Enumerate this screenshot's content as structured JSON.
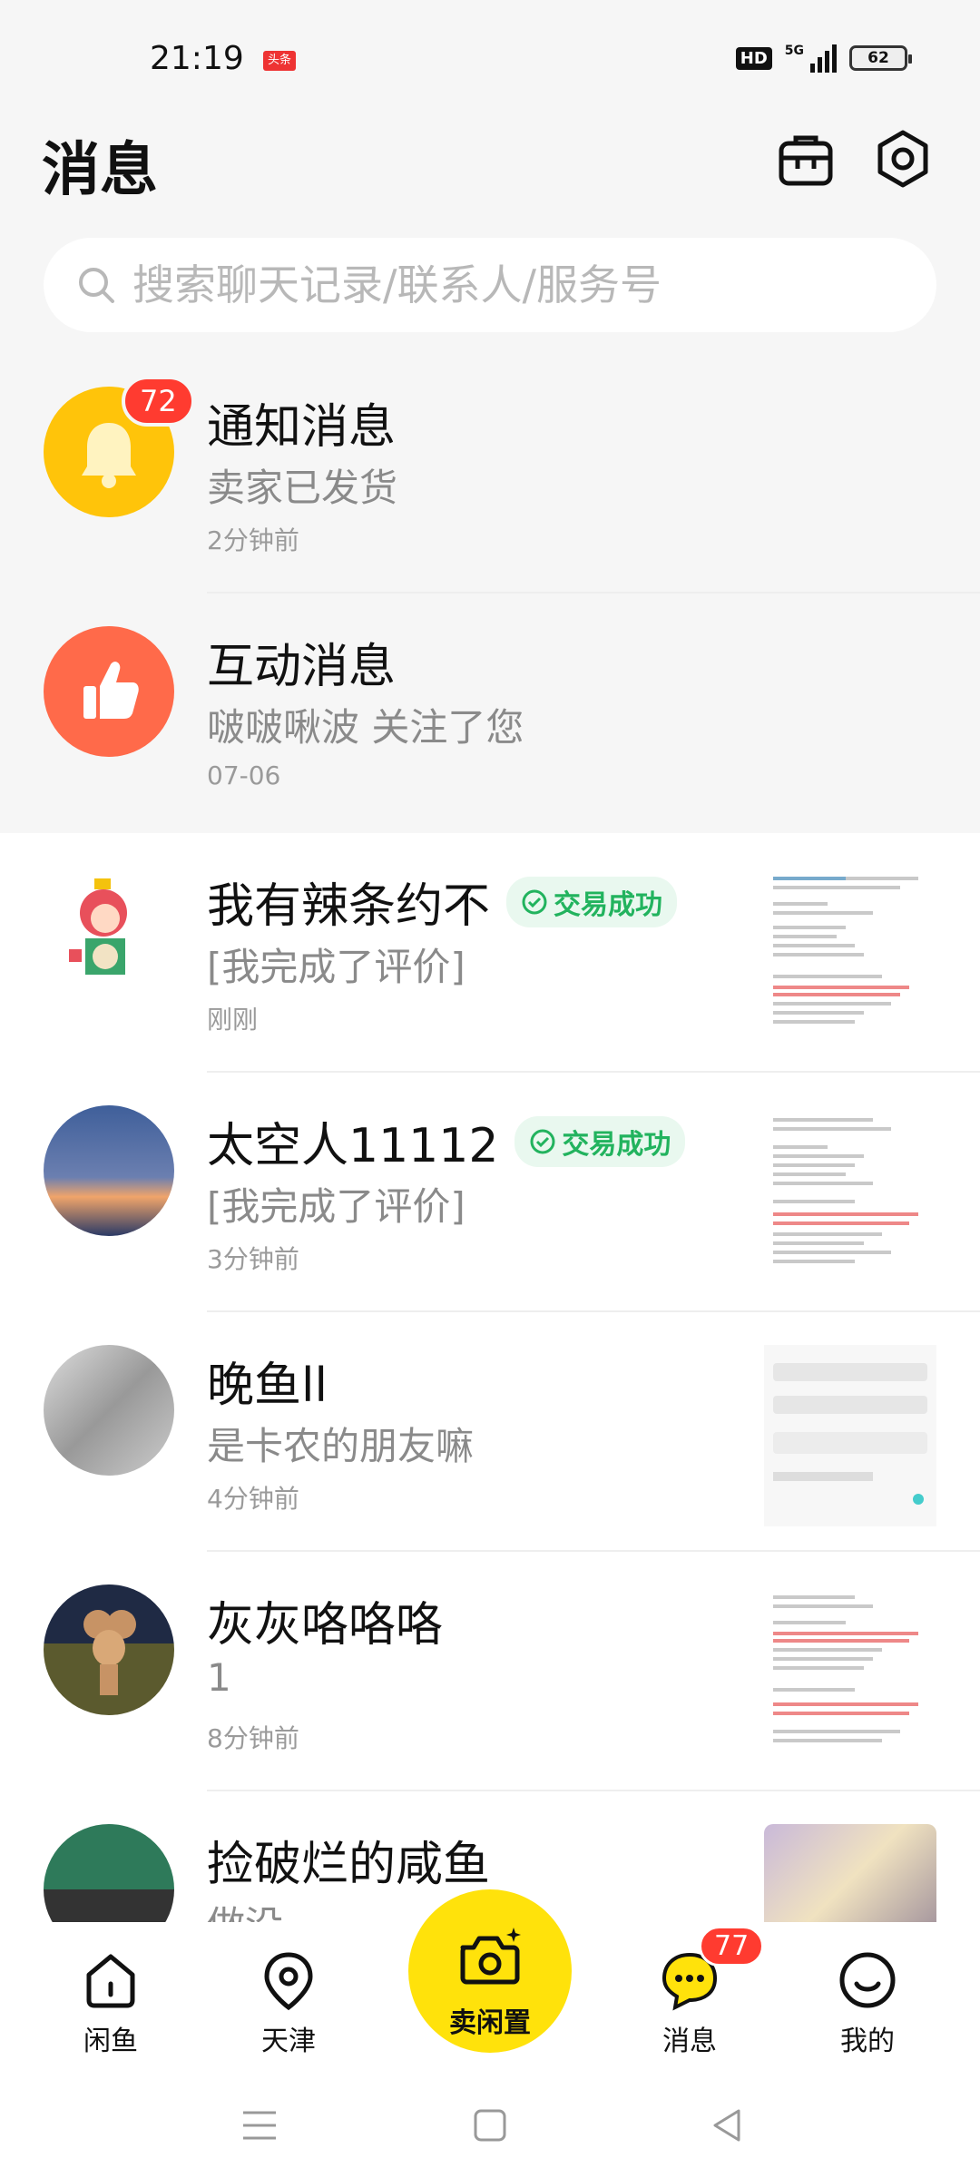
{
  "status_bar": {
    "time": "21:19",
    "news_tag": "头条",
    "hd": "HD",
    "network": "5G",
    "battery": "62"
  },
  "header": {
    "title": "消息",
    "icons": [
      "shopping-bag-icon",
      "settings-icon"
    ]
  },
  "search": {
    "placeholder": "搜索聊天记录/联系人/服务号",
    "icon": "search-icon"
  },
  "messages": [
    {
      "name": "通知消息",
      "preview": "卖家已发货",
      "time": "2分钟前",
      "badge": "72",
      "avatar": "bell-icon",
      "avatar_color": "#ffc40a"
    },
    {
      "name": "互动消息",
      "preview": "啵啵啾波 关注了您",
      "time": "07-06",
      "avatar": "thumbs-up-icon",
      "avatar_color": "#ff6a4a"
    },
    {
      "name": "我有辣条约不",
      "preview": "[我完成了评价]",
      "time": "刚刚",
      "status": "交易成功"
    },
    {
      "name": "太空人11112",
      "preview": "[我完成了评价]",
      "time": "3分钟前",
      "status": "交易成功"
    },
    {
      "name": "晚鱼ll",
      "preview": "是卡农的朋友嘛",
      "time": "4分钟前"
    },
    {
      "name": "灰灰咯咯咯",
      "preview": "1",
      "time": "8分钟前"
    },
    {
      "name": "捡破烂的咸鱼",
      "preview": "做没"
    }
  ],
  "bottom_nav": {
    "items": [
      "闲鱼",
      "天津",
      "消息",
      "我的"
    ],
    "sell_label": "卖闲置",
    "messages_badge": "77"
  },
  "colors": {
    "brand_yellow": "#ffe20b",
    "badge_red": "#ff3b30",
    "success_green": "#22b35e"
  }
}
